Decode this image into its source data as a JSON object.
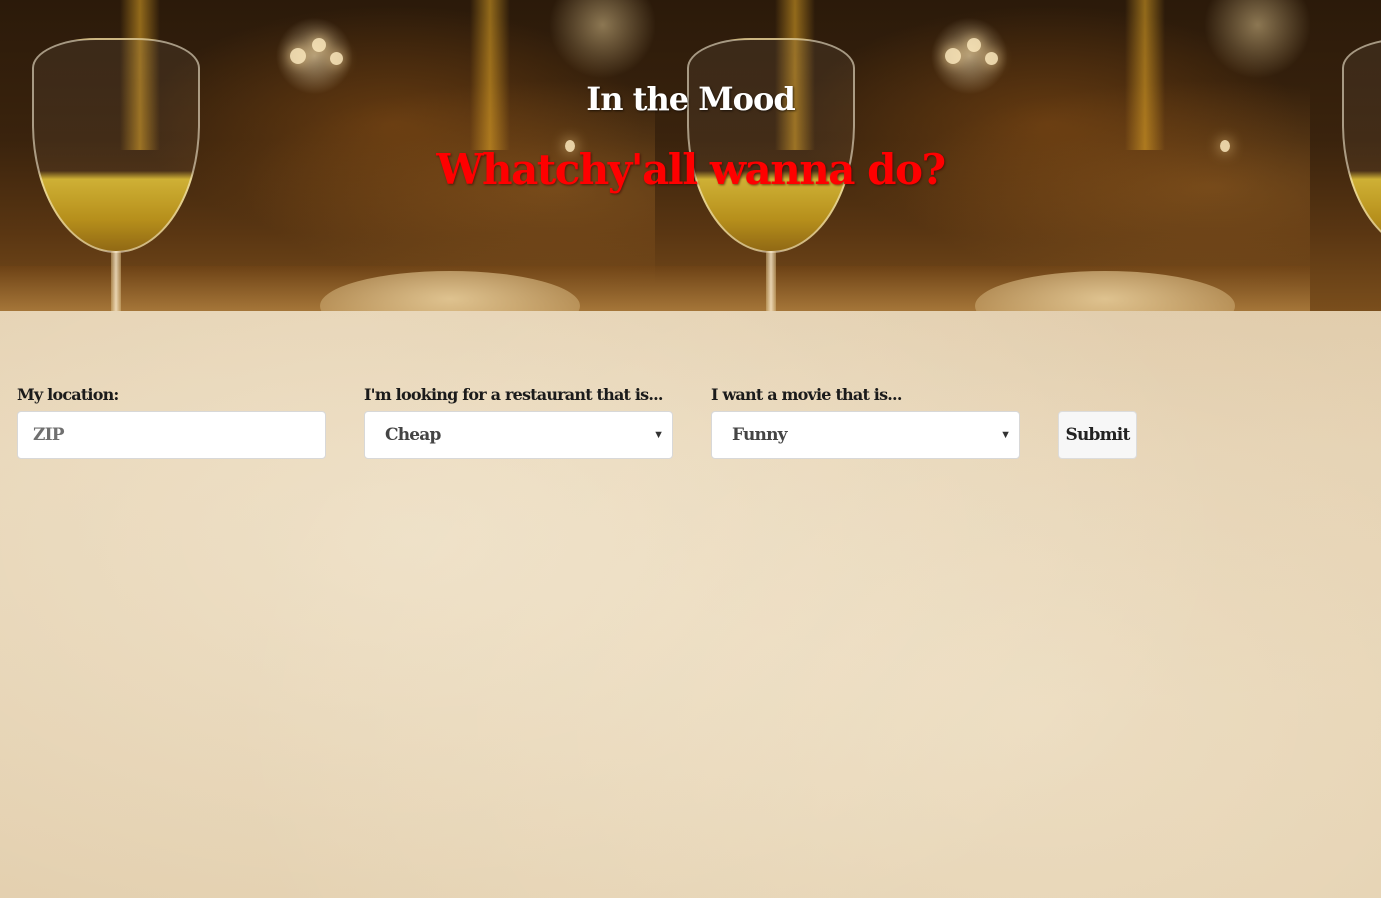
{
  "header": {
    "title": "In the Mood",
    "subtitle": "Whatchy'all wanna do?"
  },
  "form": {
    "location": {
      "label": "My location:",
      "value": "",
      "placeholder": "ZIP"
    },
    "restaurant": {
      "label": "I'm looking for a restaurant that is...",
      "selected": "Cheap"
    },
    "movie": {
      "label": "I want a movie that is...",
      "selected": "Funny"
    },
    "submit_label": "Submit"
  },
  "colors": {
    "title": "#ffffff",
    "subtitle": "#ff0000",
    "page_background": "#e3cfae"
  },
  "icons": {
    "select_arrow": "triangle-down-icon"
  }
}
